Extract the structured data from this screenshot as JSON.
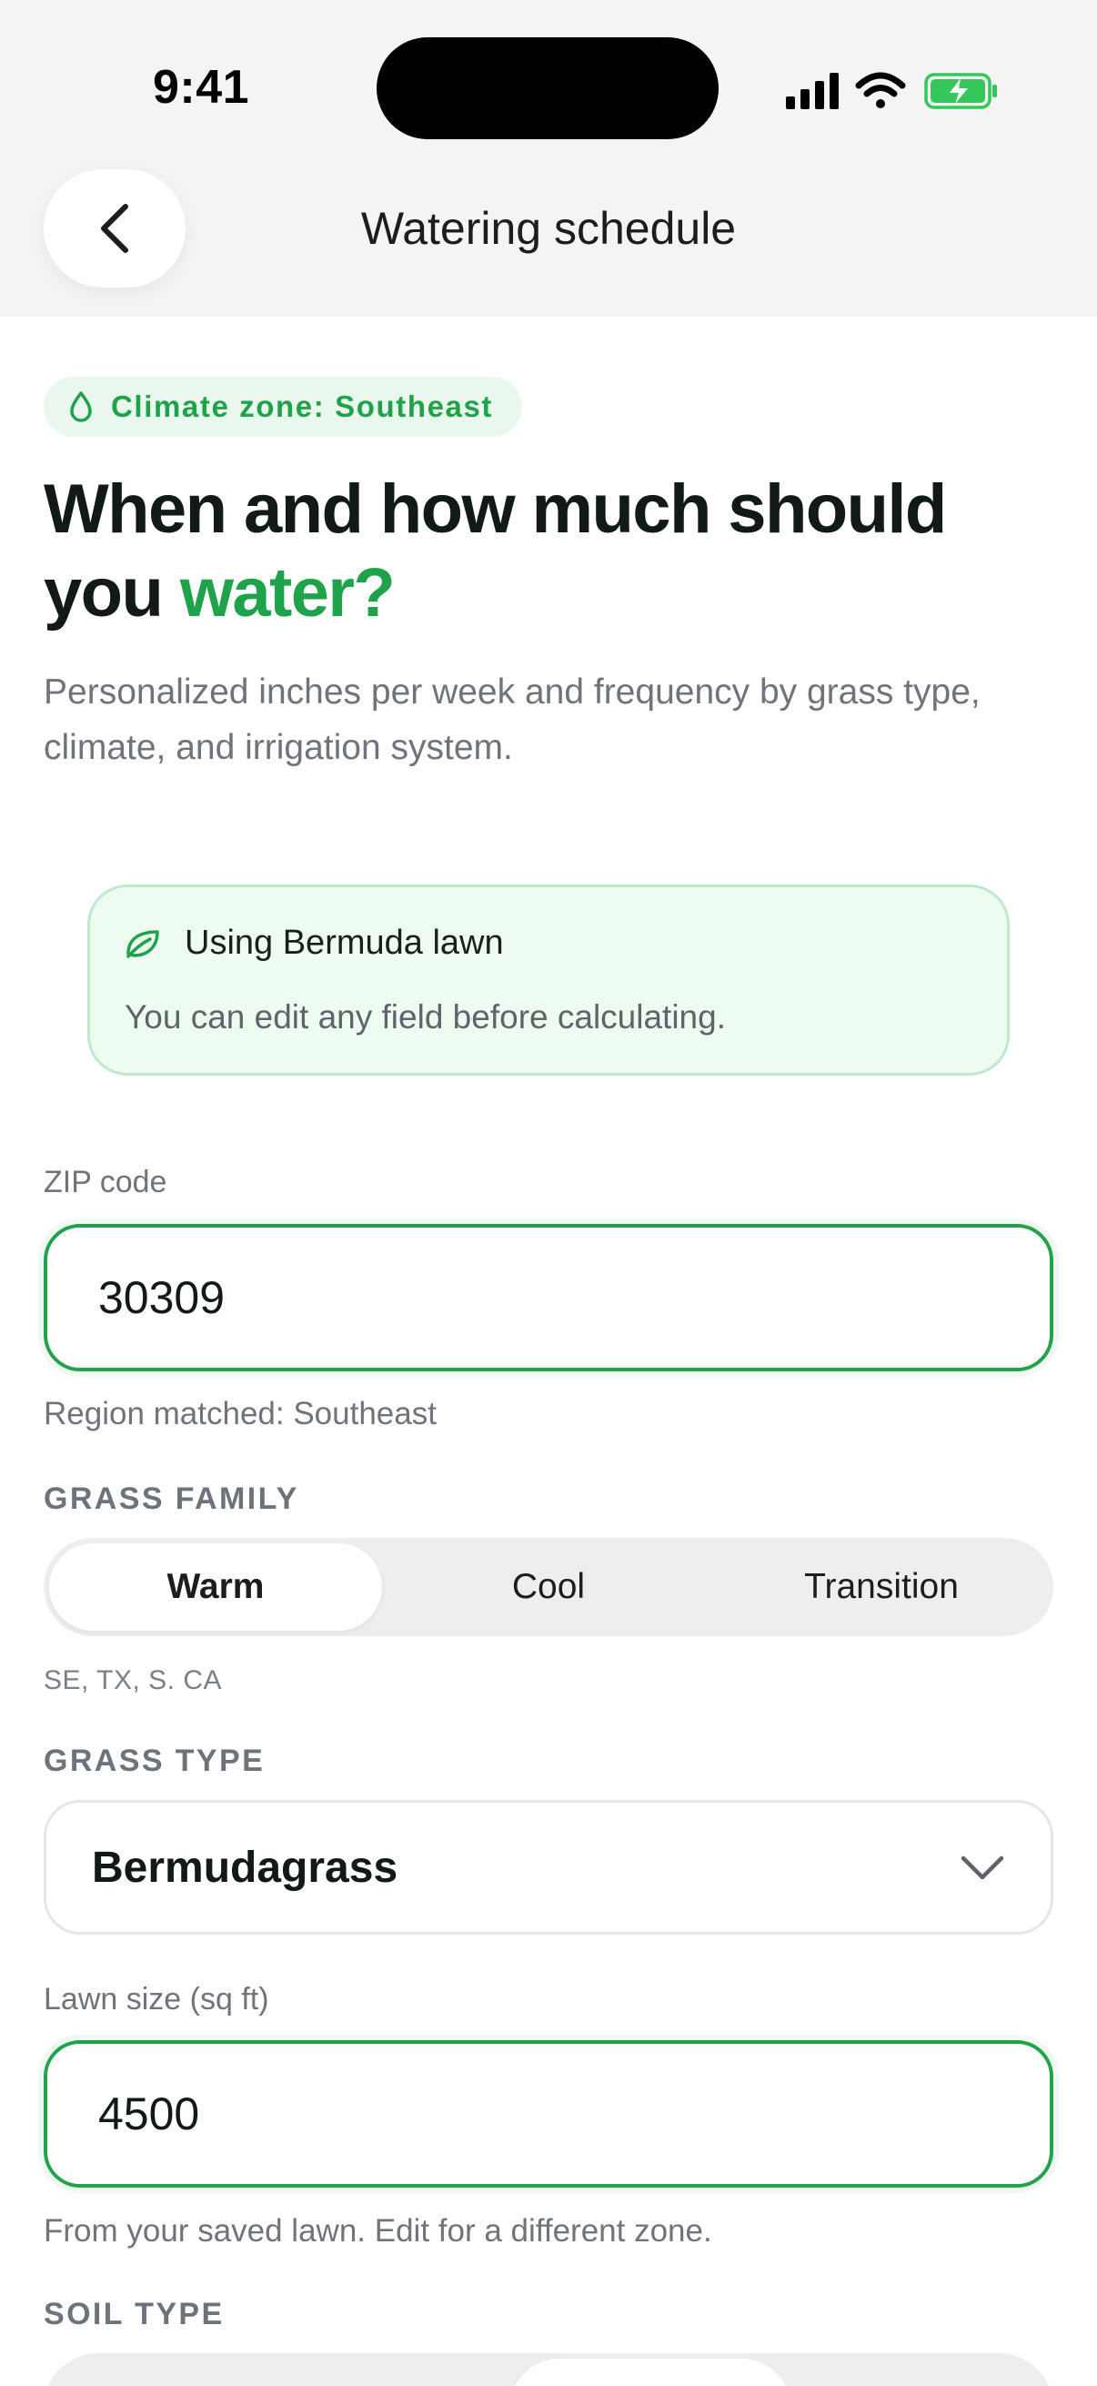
{
  "status_bar": {
    "time": "9:41"
  },
  "header": {
    "title": "Watering schedule",
    "back_icon": "chevron-left-icon"
  },
  "zone_badge": {
    "label": "Climate zone: Southeast",
    "icon": "droplet-icon",
    "color": "#1fa34a"
  },
  "headline": {
    "part1": "When and how much should you ",
    "accent": "water?"
  },
  "subtitle": "Personalized inches per week and frequency by grass type, climate, and irrigation system.",
  "info_card": {
    "icon": "leaf-icon",
    "title": "Using Bermuda lawn",
    "note": "You can edit any field before calculating."
  },
  "zip": {
    "label": "ZIP code",
    "value": "30309",
    "helper": "Region matched: Southeast"
  },
  "grass_family": {
    "label": "GRASS FAMILY",
    "options": [
      "Warm",
      "Cool",
      "Transition"
    ],
    "selected": "Warm",
    "helper": "SE, TX, S. CA"
  },
  "grass_type": {
    "label": "GRASS TYPE",
    "value": "Bermudagrass",
    "icon": "chevron-down-icon"
  },
  "lawn_size": {
    "label": "Lawn size (sq ft)",
    "value": "4500",
    "helper": "From your saved lawn. Edit for a different zone."
  },
  "soil_type": {
    "label": "SOIL TYPE"
  },
  "colors": {
    "accent": "#1fa34a",
    "card_bg": "#eefbf1",
    "card_border": "#bfe9cb"
  }
}
